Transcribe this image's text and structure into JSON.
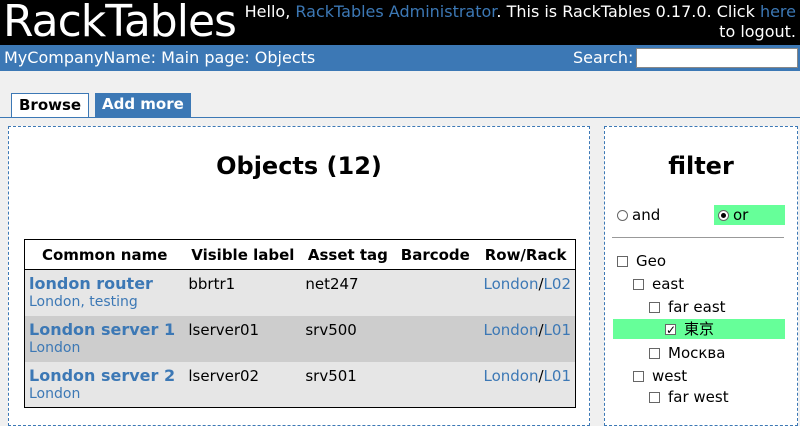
{
  "banner": {
    "logo_text": "RackTables",
    "greeting_prefix": "Hello, ",
    "user_name": "RackTables Administrator",
    "greeting_middle": ". This is RackTables 0.17.0. Click ",
    "here_link": "here",
    "greeting_suffix": " to logout."
  },
  "pathbar": {
    "path": "MyCompanyName: Main page: Objects",
    "search_label": "Search:",
    "search_value": ""
  },
  "tabs": [
    {
      "label": "Browse",
      "active": true
    },
    {
      "label": "Add more",
      "active": false
    }
  ],
  "objects": {
    "title": "Objects (12)",
    "columns": [
      "Common name",
      "Visible label",
      "Asset tag",
      "Barcode",
      "Row/Rack"
    ],
    "rows": [
      {
        "name": "london router",
        "tags": [
          "London",
          "testing"
        ],
        "visible_label": "bbrtr1",
        "asset_tag": "net247",
        "barcode": "",
        "row": "London",
        "rack": "L02"
      },
      {
        "name": "London server 1",
        "tags": [
          "London"
        ],
        "visible_label": "lserver01",
        "asset_tag": "srv500",
        "barcode": "",
        "row": "London",
        "rack": "L01"
      },
      {
        "name": "London server 2",
        "tags": [
          "London"
        ],
        "visible_label": "lserver02",
        "asset_tag": "srv501",
        "barcode": "",
        "row": "London",
        "rack": "L01"
      }
    ]
  },
  "filter": {
    "title": "filter",
    "and_label": "and",
    "or_label": "or",
    "selected_mode": "or",
    "tree": [
      {
        "label": "Geo",
        "level": 0,
        "checked": false,
        "highlighted": false
      },
      {
        "label": "east",
        "level": 1,
        "checked": false,
        "highlighted": false
      },
      {
        "label": "far east",
        "level": 2,
        "checked": false,
        "highlighted": false
      },
      {
        "label": "東京",
        "level": 3,
        "checked": true,
        "highlighted": true
      },
      {
        "label": "Москва",
        "level": 2,
        "checked": false,
        "highlighted": false
      },
      {
        "label": "west",
        "level": 1,
        "checked": false,
        "highlighted": false
      },
      {
        "label": "far west",
        "level": 2,
        "checked": false,
        "highlighted": false
      }
    ]
  },
  "colors": {
    "brand_blue": "#3c78b5",
    "highlight_green": "#66ff99",
    "row_light": "#e6e6e6",
    "row_dark": "#cdcdcd"
  }
}
